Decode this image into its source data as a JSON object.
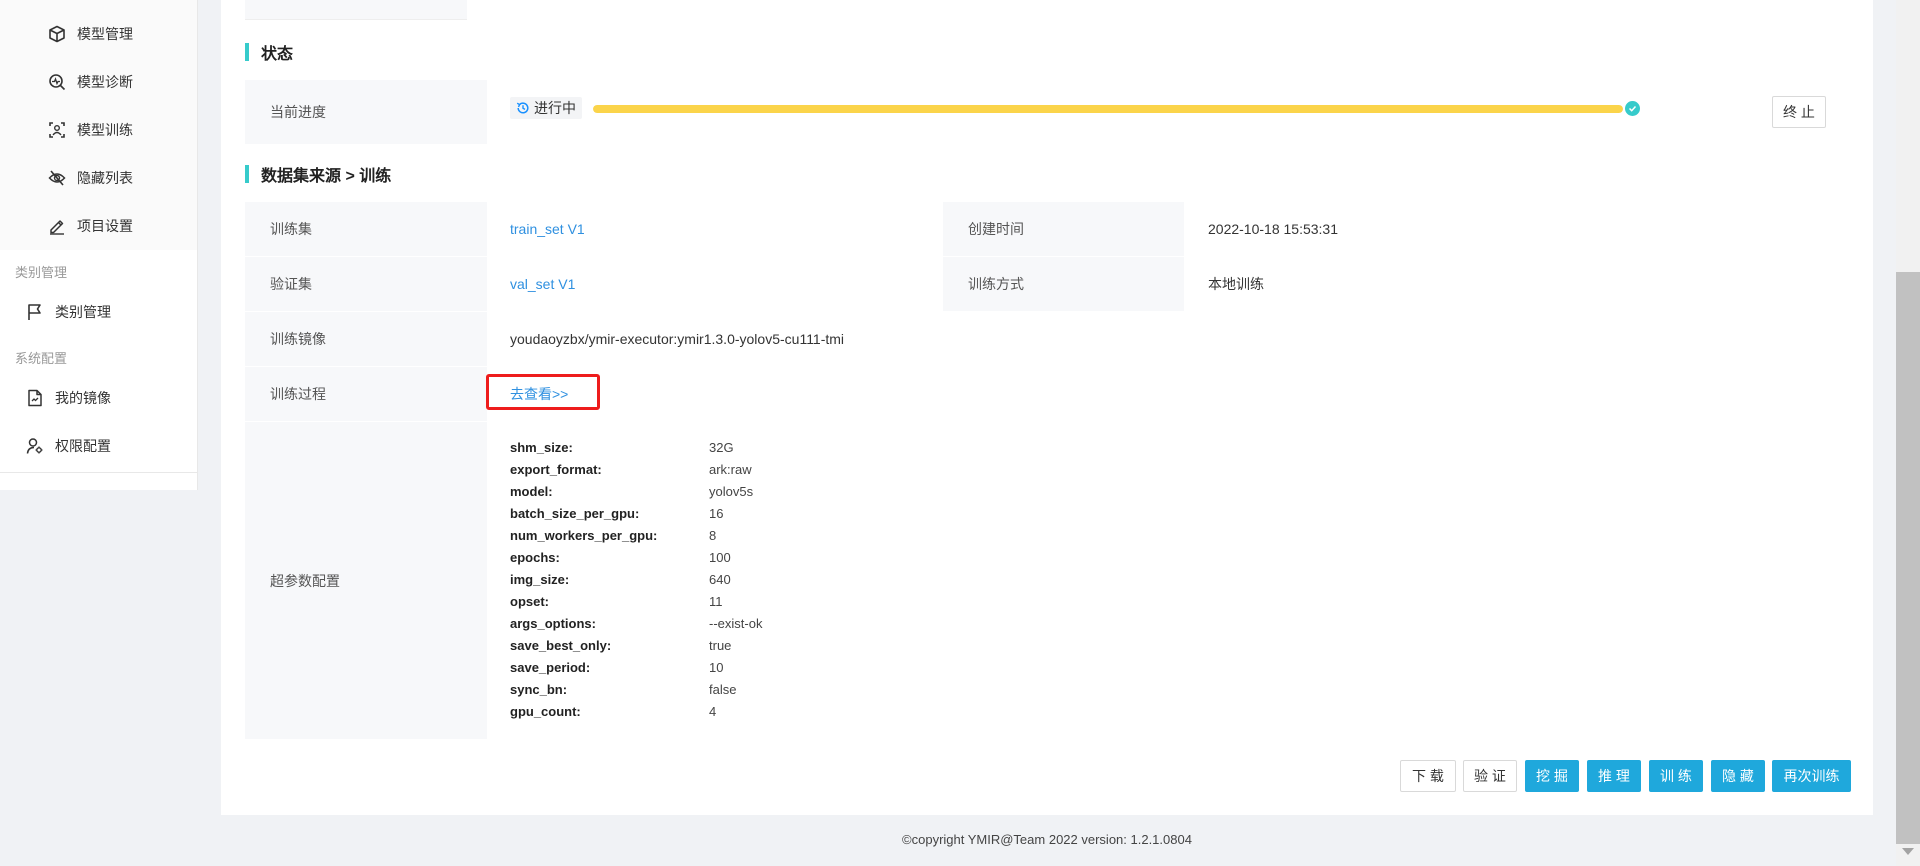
{
  "sidebar": {
    "items": [
      {
        "label": "模型管理",
        "icon": "cube-icon"
      },
      {
        "label": "模型诊断",
        "icon": "diagnose-icon"
      },
      {
        "label": "模型训练",
        "icon": "train-icon"
      },
      {
        "label": "隐藏列表",
        "icon": "eye-hidden-icon"
      },
      {
        "label": "项目设置",
        "icon": "edit-icon"
      }
    ],
    "group_category": "类别管理",
    "category_item": "类别管理",
    "group_system": "系统配置",
    "system_items": [
      {
        "label": "我的镜像",
        "icon": "file-image-icon"
      },
      {
        "label": "权限配置",
        "icon": "user-setting-icon"
      }
    ]
  },
  "status_section": {
    "title": "状态",
    "progress_label": "当前进度",
    "status_tag": "进行中",
    "progress": 1.0,
    "stop_button": "终 止"
  },
  "source_section": {
    "title": "数据集来源 > 训练",
    "rows": {
      "train_set_label": "训练集",
      "train_set_value": "train_set V1",
      "create_time_label": "创建时间",
      "create_time_value": "2022-10-18 15:53:31",
      "val_set_label": "验证集",
      "val_set_value": "val_set V1",
      "train_mode_label": "训练方式",
      "train_mode_value": "本地训练",
      "image_label": "训练镜像",
      "image_value": "youdaoyzbx/ymir-executor:ymir1.3.0-yolov5-cu111-tmi",
      "process_label": "训练过程",
      "process_link": "去查看>>",
      "hyper_label": "超参数配置"
    },
    "hyper_params": [
      {
        "key": "shm_size:",
        "value": "32G"
      },
      {
        "key": "export_format:",
        "value": "ark:raw"
      },
      {
        "key": "model:",
        "value": "yolov5s"
      },
      {
        "key": "batch_size_per_gpu:",
        "value": "16"
      },
      {
        "key": "num_workers_per_gpu:",
        "value": "8"
      },
      {
        "key": "epochs:",
        "value": "100"
      },
      {
        "key": "img_size:",
        "value": "640"
      },
      {
        "key": "opset:",
        "value": "11"
      },
      {
        "key": "args_options:",
        "value": "--exist-ok"
      },
      {
        "key": "save_best_only:",
        "value": "true"
      },
      {
        "key": "save_period:",
        "value": "10"
      },
      {
        "key": "sync_bn:",
        "value": "false"
      },
      {
        "key": "gpu_count:",
        "value": "4"
      }
    ]
  },
  "actions": {
    "download": "下 载",
    "verify": "验 证",
    "mine": "挖 掘",
    "infer": "推 理",
    "train": "训 练",
    "hide": "隐 藏",
    "retrain": "再次训练"
  },
  "footer": "©copyright YMIR@Team 2022 version: 1.2.1.0804",
  "colors": {
    "accent": "#36cbcb",
    "progress": "#fbd44a",
    "primary_button": "#1fa8dc",
    "link": "#2f90e0",
    "highlight_box": "#ee1c1c"
  }
}
